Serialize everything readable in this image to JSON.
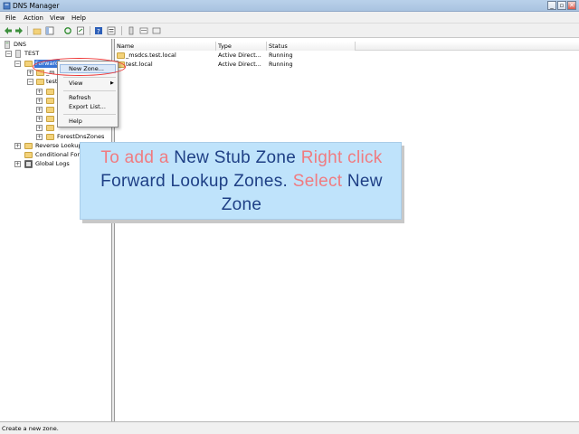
{
  "window": {
    "title": "DNS Manager"
  },
  "title_buttons": [
    "_",
    "▫",
    "✕"
  ],
  "menu": [
    "File",
    "Action",
    "View",
    "Help"
  ],
  "tree": {
    "root": "DNS",
    "server": "TEST",
    "forward_zones": "Forward Lookup Zones",
    "forward_zones_visible": "Forward",
    "child_msdcs": "_m",
    "child_test": "test",
    "forest_dns": "ForestDnsZones",
    "reverse": "Reverse Lookup Zones",
    "conditional": "Conditional Forwarders",
    "global_logs": "Global Logs"
  },
  "context_menu": {
    "new_zone": "New Zone...",
    "view": "View",
    "refresh": "Refresh",
    "export": "Export List...",
    "help": "Help"
  },
  "list": {
    "columns": [
      "Name",
      "Type",
      "Status"
    ],
    "rows": [
      {
        "name": "_msdcs.test.local",
        "type": "Active Direct...",
        "status": "Running"
      },
      {
        "name": "test.local",
        "type": "Active Direct...",
        "status": "Running"
      }
    ]
  },
  "callout": {
    "p1": "To add a ",
    "p2": "New Stub Zone",
    "p3": " Right click ",
    "p4": "Forward Lookup Zones.",
    "p5": " Select ",
    "p6": "New Zone"
  },
  "status": "Create a new zone.",
  "colors": {
    "callout_bg": "#bfe3fb",
    "highlight_red": "#f07b80",
    "highlight_navy": "#1e3f85",
    "selection": "#3875d7"
  }
}
